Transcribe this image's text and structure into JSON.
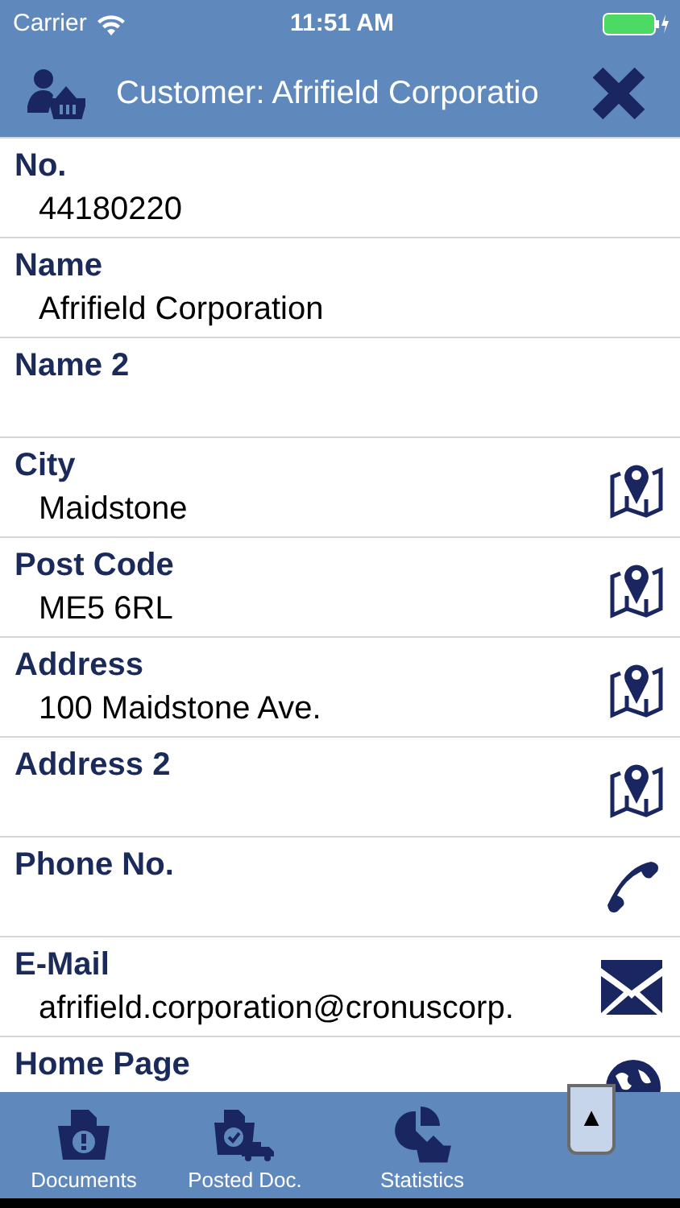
{
  "status_bar": {
    "carrier": "Carrier",
    "time": "11:51 AM"
  },
  "header": {
    "title": "Customer: Afrifield Corporatio"
  },
  "fields": [
    {
      "label": "No.",
      "value": "44180220",
      "kind": "text"
    },
    {
      "label": "Name",
      "value": "Afrifield Corporation",
      "kind": "text"
    },
    {
      "label": "Name 2",
      "kind": "text"
    },
    {
      "label": "City",
      "value": "Maidstone",
      "kind": "map"
    },
    {
      "label": "Post Code",
      "value": "ME5 6RL",
      "kind": "map"
    },
    {
      "label": "Address",
      "value": "100 Maidstone Ave.",
      "kind": "map"
    },
    {
      "label": "Address 2",
      "kind": "map"
    },
    {
      "label": "Phone No.",
      "kind": "phone"
    },
    {
      "label": "E-Mail",
      "value": "afrifield.corporation@cronuscorp.",
      "kind": "mail"
    },
    {
      "label": "Home Page",
      "kind": "web"
    }
  ],
  "tabs": [
    {
      "label": "Documents",
      "kind": "documents"
    },
    {
      "label": "Posted Doc.",
      "kind": "posted"
    },
    {
      "label": "Statistics",
      "kind": "statistics"
    }
  ],
  "more_handle": {
    "symbol": "▲"
  }
}
